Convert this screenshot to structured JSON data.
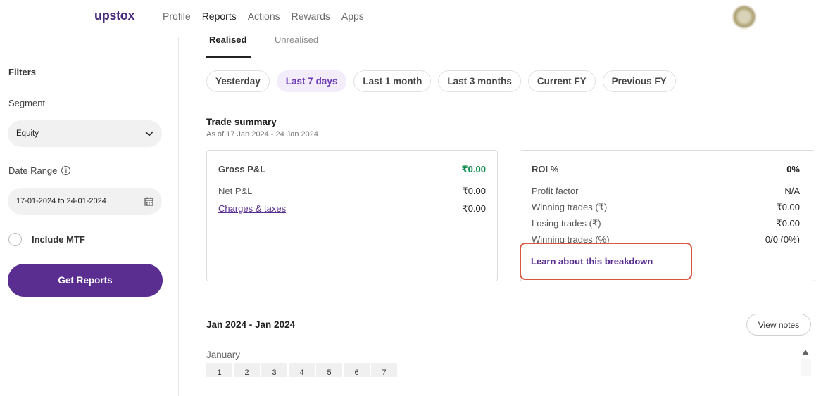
{
  "app": {
    "logo": "upstox"
  },
  "nav": {
    "items": [
      "Profile",
      "Reports",
      "Actions",
      "Rewards",
      "Apps"
    ],
    "active": "Reports"
  },
  "sidebar": {
    "filters_title": "Filters",
    "segment_label": "Segment",
    "segment_value": "Equity",
    "date_range_label": "Date Range",
    "date_range_value": "17-01-2024 to 24-01-2024",
    "include_mtf_label": "Include MTF",
    "get_reports_label": "Get Reports"
  },
  "tabs": {
    "realised": "Realised",
    "unrealised": "Unrealised"
  },
  "chips": [
    "Yesterday",
    "Last 7 days",
    "Last 1 month",
    "Last 3 months",
    "Current FY",
    "Previous FY"
  ],
  "chips_active": "Last 7 days",
  "trade_summary": {
    "title": "Trade summary",
    "subtitle": "As of 17 Jan 2024 - 24 Jan 2024",
    "left": {
      "gross_label": "Gross P&L",
      "gross_value": "₹0.00",
      "net_label": "Net P&L",
      "net_value": "₹0.00",
      "charges_label": "Charges & taxes",
      "charges_value": "₹0.00"
    },
    "right": {
      "roi_label": "ROI %",
      "roi_value": "0%",
      "profit_factor_label": "Profit factor",
      "profit_factor_value": "N/A",
      "winning_label": "Winning trades (₹)",
      "winning_value": "₹0.00",
      "losing_label": "Losing trades (₹)",
      "losing_value": "₹0.00",
      "winning_pct_label": "Winning trades (%)",
      "winning_pct_value": "0/0 (0%)",
      "learn_label": "Learn about this breakdown"
    }
  },
  "calendar": {
    "period": "Jan 2024 - Jan 2024",
    "view_notes": "View notes",
    "month": "January",
    "days": [
      "1",
      "2",
      "3",
      "4",
      "5",
      "6",
      "7"
    ]
  },
  "colors": {
    "brand": "#5a2d91",
    "positive": "#0a8a4a",
    "highlight": "#d9573f"
  }
}
